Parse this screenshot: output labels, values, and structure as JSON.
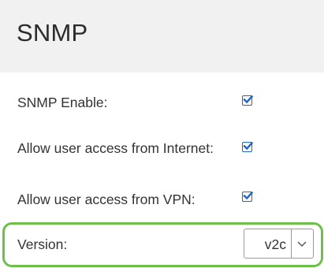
{
  "header": {
    "title": "SNMP"
  },
  "settings": {
    "snmp_enable": {
      "label": "SNMP Enable:",
      "checked": true
    },
    "allow_internet": {
      "label": "Allow user access from Internet:",
      "checked": true
    },
    "allow_vpn": {
      "label": "Allow user access from VPN:",
      "checked": true
    },
    "version": {
      "label": "Version:",
      "selected": "v2c"
    }
  },
  "colors": {
    "checkbox_blue": "#1c66c6",
    "highlight_green": "#6cc04a",
    "header_bg": "#f1f1f1"
  }
}
